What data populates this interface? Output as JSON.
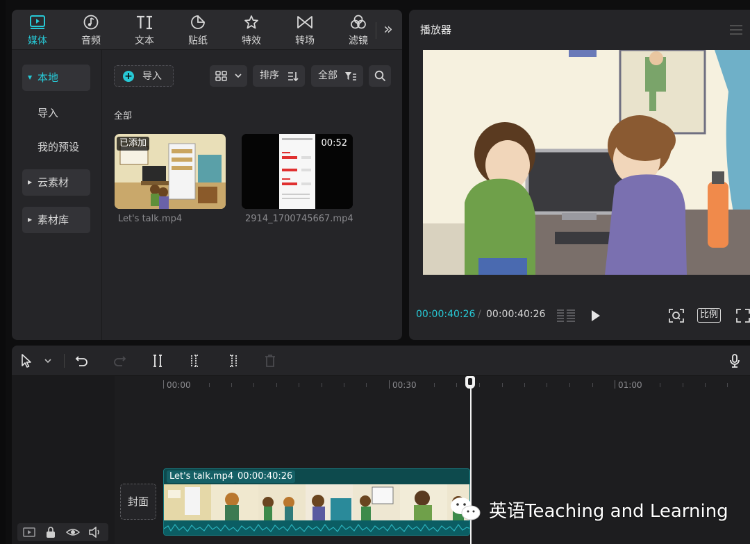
{
  "media_tabs": [
    {
      "label": "媒体",
      "icon": "media-icon",
      "active": true
    },
    {
      "label": "音频",
      "icon": "audio-icon"
    },
    {
      "label": "文本",
      "icon": "text-icon"
    },
    {
      "label": "贴纸",
      "icon": "sticker-icon"
    },
    {
      "label": "特效",
      "icon": "effects-icon"
    },
    {
      "label": "转场",
      "icon": "transition-icon"
    },
    {
      "label": "滤镜",
      "icon": "filter-icon"
    }
  ],
  "sidebar": {
    "items": [
      {
        "label": "本地",
        "active": true
      },
      {
        "label": "导入"
      },
      {
        "label": "我的预设"
      },
      {
        "label": "云素材"
      },
      {
        "label": "素材库"
      }
    ]
  },
  "content": {
    "import_label": "导入",
    "sort_label": "排序",
    "filter_label": "全部",
    "section_label": "全部",
    "files": [
      {
        "name": "Let's talk.mp4",
        "badge": "已添加"
      },
      {
        "name": "2914_1700745667.mp4",
        "duration": "00:52"
      }
    ]
  },
  "player": {
    "title": "播放器",
    "current_time": "00:00:40:26",
    "separator": "/",
    "total_time": "00:00:40:26",
    "ratio_label": "比例"
  },
  "timeline": {
    "ruler_labels": [
      "00:00",
      "00:30",
      "01:00"
    ],
    "cover_label": "封面",
    "clip_name": "Let's talk.mp4",
    "clip_duration": "00:00:40:26"
  },
  "watermark": {
    "text": "英语Teaching and Learning"
  },
  "colors": {
    "accent": "#27c9d6",
    "panel": "#252528",
    "background": "#0e0e0f",
    "clip": "#0d4a4d"
  }
}
